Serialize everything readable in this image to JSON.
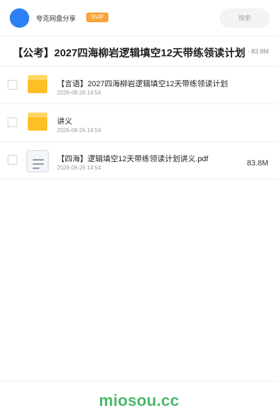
{
  "header": {
    "brand": "夸克网盘分享",
    "badge": "SVIP",
    "search_placeholder": "搜索"
  },
  "share": {
    "title": "【公考】2027四海柳岩逻辑填空12天带练领读计划",
    "total_size": "· 83.8M"
  },
  "files": [
    {
      "type": "folder",
      "name": "【言语】2027四海柳岩逻辑填空12天带练领读计划",
      "date": "2026-08-26 14:54",
      "size": ""
    },
    {
      "type": "folder",
      "name": "讲义",
      "date": "2026-08-26 14:54",
      "size": ""
    },
    {
      "type": "file",
      "name": "【四海】逻辑填空12天带练领读计划讲义.pdf",
      "date": "2026-08-26 14:54",
      "size": "83.8M"
    }
  ],
  "footer": {
    "watermark": "miosou.cc"
  },
  "colors": {
    "accent": "#2d7ff5",
    "svip": "#f7a43a",
    "folder": "#fdbf26",
    "watermark": "#4bb86b"
  }
}
